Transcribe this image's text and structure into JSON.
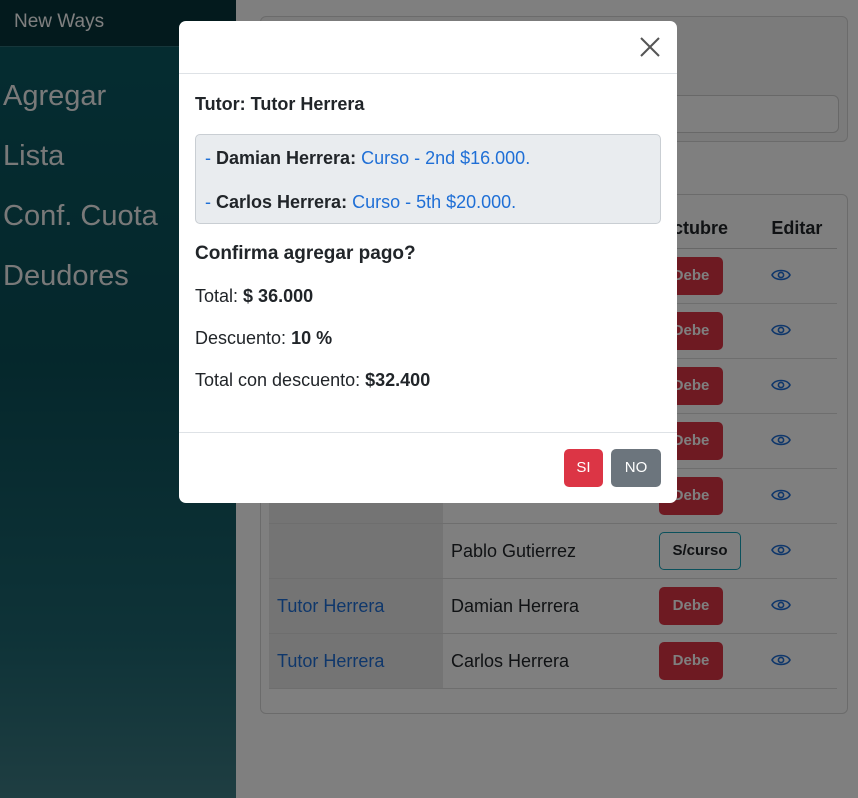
{
  "sidebar": {
    "brand": "New Ways",
    "items": [
      {
        "label": "Agregar"
      },
      {
        "label": "Lista"
      },
      {
        "label": "Conf. Cuota"
      },
      {
        "label": "Deudores"
      }
    ]
  },
  "table": {
    "headers": {
      "month": "Octubre",
      "edit": "Editar"
    },
    "rows": [
      {
        "tutor": "",
        "name": "",
        "status": "Debe"
      },
      {
        "tutor": "",
        "name": "",
        "status": "Debe"
      },
      {
        "tutor": "",
        "name": "",
        "status": "Debe"
      },
      {
        "tutor": "",
        "name": "",
        "status": "Debe"
      },
      {
        "tutor": "",
        "name": "",
        "status": "Debe"
      },
      {
        "tutor": "",
        "name": "Pablo Gutierrez",
        "status": "S/curso"
      },
      {
        "tutor": "Tutor Herrera",
        "name": "Damian Herrera",
        "status": "Debe"
      },
      {
        "tutor": "Tutor Herrera",
        "name": "Carlos Herrera",
        "status": "Debe"
      }
    ]
  },
  "modal": {
    "tutor_label": "Tutor:",
    "tutor_name": "Tutor Herrera",
    "students": [
      {
        "prefix": "- ",
        "name": "Damian Herrera:",
        "course": "Curso - 2nd $16.000."
      },
      {
        "prefix": "- ",
        "name": "Carlos Herrera:",
        "course": "Curso - 5th $20.000."
      }
    ],
    "confirm_text": "Confirma agregar pago?",
    "total_label": "Total:",
    "total_value": "$ 36.000",
    "discount_label": "Descuento:",
    "discount_value": "10 %",
    "discounted_label": "Total con descuento:",
    "discounted_value": "$32.400",
    "yes_label": "SI",
    "no_label": "NO"
  },
  "colors": {
    "danger": "#dc3545",
    "secondary": "#6c757d",
    "link": "#1f6fd6",
    "info": "#17a2b8"
  }
}
